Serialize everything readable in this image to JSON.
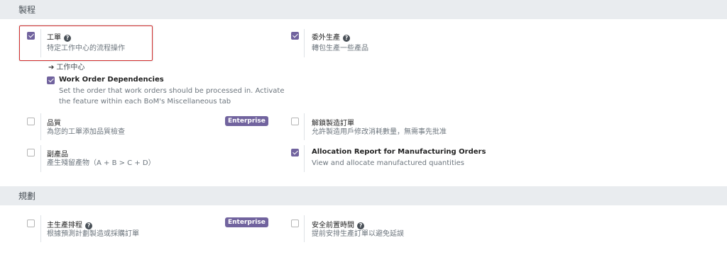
{
  "sections": {
    "manufacturing": {
      "title": "製程"
    },
    "planning": {
      "title": "規劃"
    }
  },
  "settings": {
    "work_orders": {
      "title": "工單",
      "description": "特定工作中心的流程操作",
      "checked": true,
      "link": "工作中心"
    },
    "work_order_dependencies": {
      "title": "Work Order Dependencies",
      "description_line1": "Set the order that work orders should be processed in. Activate",
      "description_line2": "the feature within each BoM's Miscellaneous tab",
      "checked": true
    },
    "subcontracting": {
      "title": "委外生產",
      "description": "轉包生產一些產品",
      "checked": true
    },
    "quality": {
      "title": "品質",
      "description": "為您的工單添加品質檢查",
      "checked": false,
      "badge": "Enterprise"
    },
    "unlock_mo": {
      "title": "解鎖製造訂單",
      "description": "允許製造用戶修改消耗數量，無需事先批准",
      "checked": false
    },
    "byproducts": {
      "title": "副產品",
      "description": "產生殘留產物（A + B > C + D）",
      "checked": false
    },
    "allocation_report": {
      "title": "Allocation Report for Manufacturing Orders",
      "description": "View and allocate manufactured quantities",
      "checked": true
    },
    "mps": {
      "title": "主生產排程",
      "description": "根據預測計劃製造或採購訂單",
      "checked": false,
      "badge": "Enterprise"
    },
    "security_lead_time": {
      "title": "安全前置時間",
      "description": "提前安排生產訂單以避免延誤",
      "checked": false
    }
  },
  "icons": {
    "help": "help-circle-icon",
    "arrow": "arrow-right-icon"
  },
  "colors": {
    "accent": "#71639e",
    "highlight": "#d32f2f"
  }
}
